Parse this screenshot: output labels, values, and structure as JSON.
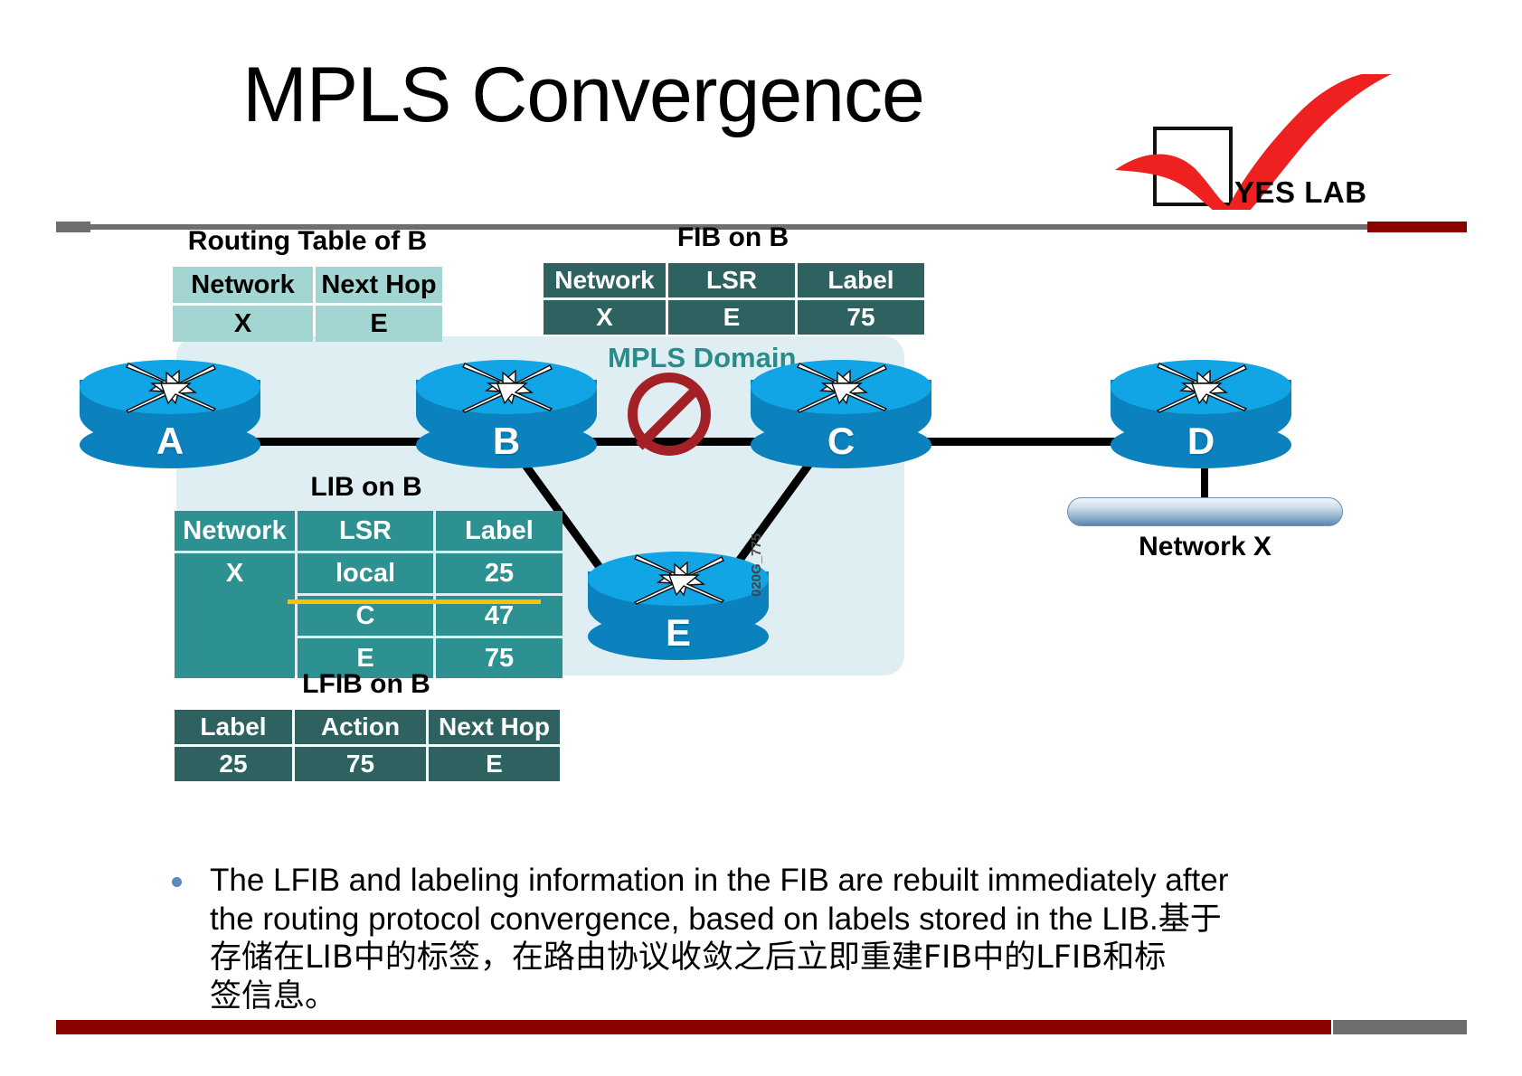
{
  "slide": {
    "title": "MPLS Convergence",
    "logo": {
      "text": "YES LAB"
    },
    "watermark": "020G_775"
  },
  "diagram": {
    "domain_label": "MPLS Domain",
    "routers": [
      {
        "id": "A",
        "label": "A"
      },
      {
        "id": "B",
        "label": "B"
      },
      {
        "id": "C",
        "label": "C"
      },
      {
        "id": "D",
        "label": "D"
      },
      {
        "id": "E",
        "label": "E"
      }
    ],
    "network_segment_label": "Network X",
    "broken_link": {
      "from": "B",
      "to": "C",
      "status": "down"
    }
  },
  "tables": {
    "routing_table_b": {
      "title": "Routing Table of B",
      "columns": [
        "Network",
        "Next Hop"
      ],
      "rows": [
        [
          "X",
          "E"
        ]
      ]
    },
    "fib_on_b": {
      "title": "FIB on B",
      "columns": [
        "Network",
        "LSR",
        "Label"
      ],
      "rows": [
        [
          "X",
          "E",
          "75"
        ]
      ]
    },
    "lib_on_b": {
      "title": "LIB on B",
      "columns": [
        "Network",
        "LSR",
        "Label"
      ],
      "rows": [
        {
          "network": "X",
          "lsr": "local",
          "label": "25",
          "struck": false
        },
        {
          "network": "",
          "lsr": "C",
          "label": "47",
          "struck": true
        },
        {
          "network": "",
          "lsr": "E",
          "label": "75",
          "struck": false
        }
      ]
    },
    "lfib_on_b": {
      "title": "LFIB on B",
      "columns": [
        "Label",
        "Action",
        "Next Hop"
      ],
      "rows": [
        [
          "25",
          "75",
          "E"
        ]
      ]
    }
  },
  "body": {
    "bullet_line1": "The LFIB and labeling information in the FIB are rebuilt immediately after",
    "bullet_line2": "the  routing protocol convergence, based on labels stored in the  LIB.基于",
    "bullet_line3": "存储在LIB中的标签，在路由协议收敛之后立即重建FIB中的LFIB和标",
    "bullet_line4": "签信息。"
  },
  "colors": {
    "accent_red": "#8c0000",
    "rule_grey": "#6e6e6e",
    "teal_dark": "#2e6260",
    "teal_mid": "#2e9191",
    "teal_light": "#a3d5d3",
    "domain_fill": "#dfeef3",
    "router_blue": "#0b82bd",
    "strike_yellow": "#ffc000"
  }
}
